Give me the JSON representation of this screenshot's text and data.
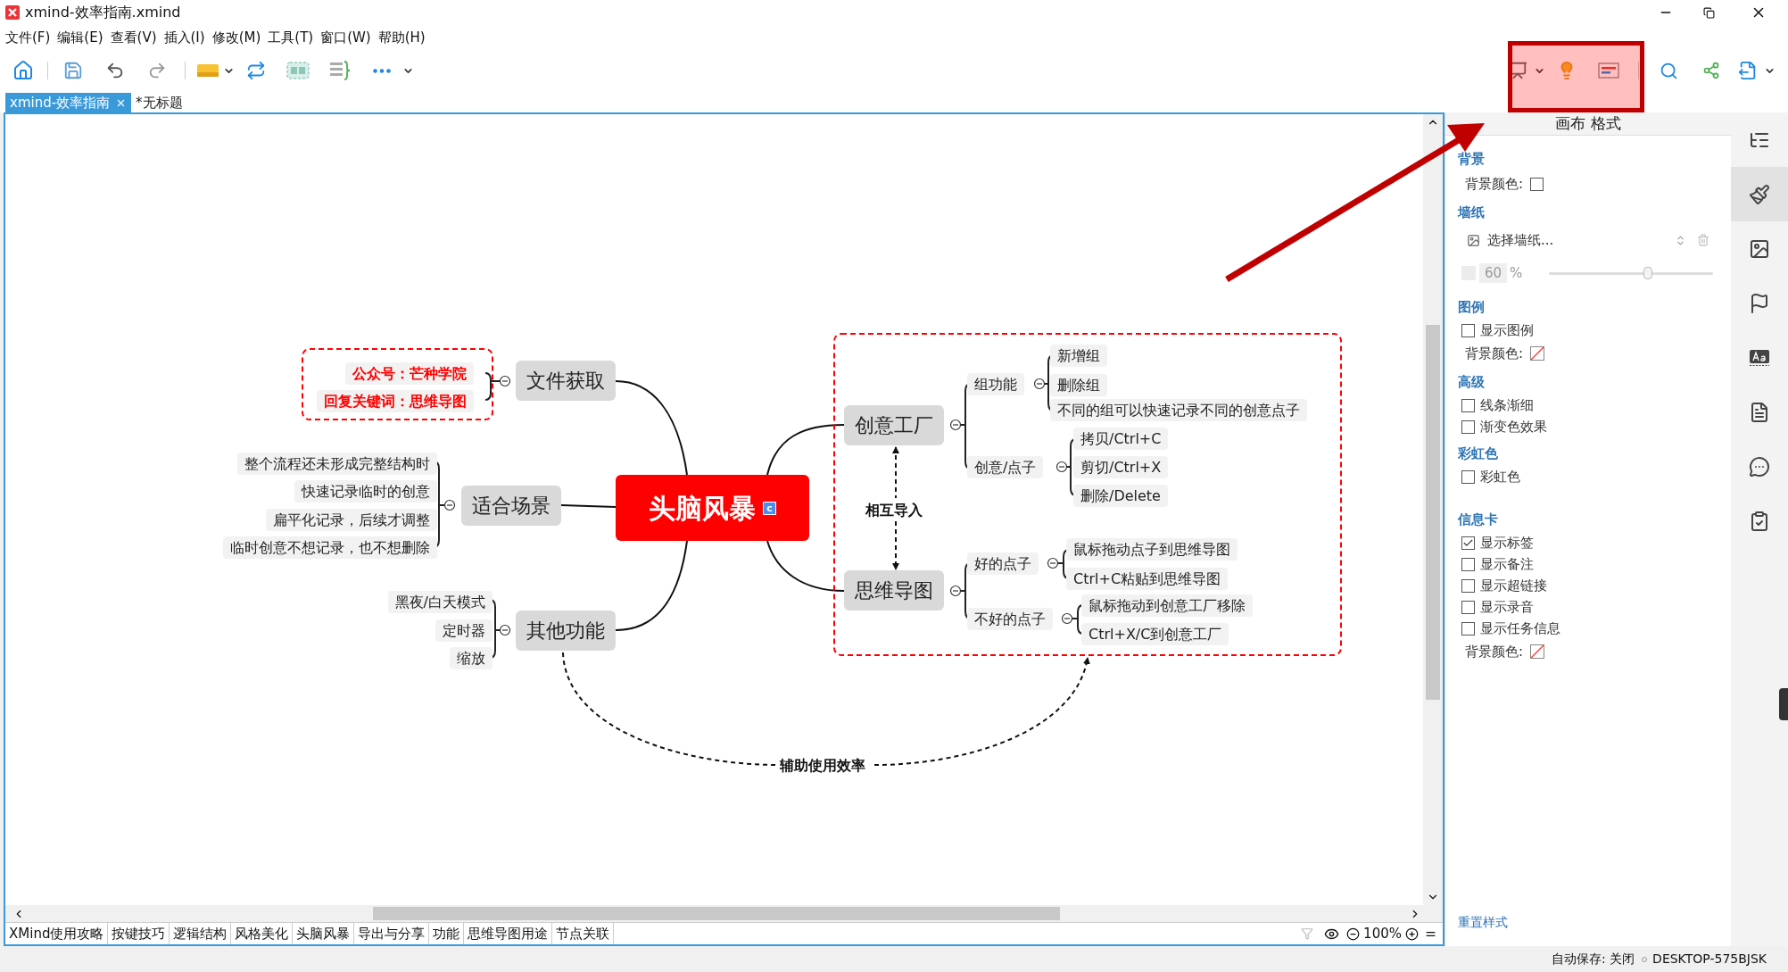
{
  "window": {
    "title": "xmind-效率指南.xmind"
  },
  "menu": [
    "文件(F)",
    "编辑(E)",
    "查看(V)",
    "插入(I)",
    "修改(M)",
    "工具(T)",
    "窗口(W)",
    "帮助(H)"
  ],
  "doc_tabs": [
    {
      "label": "xmind-效率指南",
      "selected": true
    },
    {
      "label": "*无标题",
      "selected": false
    }
  ],
  "mindmap": {
    "central": {
      "text": "头脑风暴",
      "marker": "c"
    },
    "left": [
      {
        "text": "文件获取",
        "boundary": true,
        "children": [
          {
            "text": "公众号：芒种学院",
            "highlight": true
          },
          {
            "text": "回复关键词：思维导图",
            "highlight": true
          }
        ]
      },
      {
        "text": "适合场景",
        "children": [
          {
            "text": "整个流程还未形成完整结构时",
            "highlight": false
          },
          {
            "text": "快速记录临时的创意",
            "highlight": false
          },
          {
            "text": "扁平化记录，后续才调整",
            "highlight": false
          },
          {
            "text": "临时创意不想记录，也不想删除",
            "highlight": false
          }
        ]
      },
      {
        "text": "其他功能",
        "children": [
          {
            "text": "黑夜/白天模式",
            "highlight": false
          },
          {
            "text": "定时器",
            "highlight": false
          },
          {
            "text": "缩放",
            "highlight": false
          }
        ]
      }
    ],
    "right_boundary": true,
    "right": [
      {
        "text": "创意工厂",
        "children": [
          {
            "text": "组功能",
            "children": [
              {
                "text": "新增组"
              },
              {
                "text": "删除组"
              },
              {
                "text": "不同的组可以快速记录不同的创意点子"
              }
            ]
          },
          {
            "text": "创意/点子",
            "children": [
              {
                "text": "拷贝/Ctrl+C"
              },
              {
                "text": "剪切/Ctrl+X"
              },
              {
                "text": "删除/Delete"
              }
            ]
          }
        ]
      },
      {
        "text": "思维导图",
        "children": [
          {
            "text": "好的点子",
            "children": [
              {
                "text": "鼠标拖动点子到思维导图"
              },
              {
                "text": "Ctrl+C粘贴到思维导图"
              }
            ]
          },
          {
            "text": "不好的点子",
            "children": [
              {
                "text": "鼠标拖动到创意工厂移除"
              },
              {
                "text": "Ctrl+X/C到创意工厂"
              }
            ]
          }
        ]
      }
    ],
    "relationships": [
      {
        "label": "相互导入"
      },
      {
        "label": "辅助使用效率"
      }
    ]
  },
  "format_panel": {
    "title": "画布 格式",
    "sections": [
      {
        "heading": "背景",
        "rows": [
          {
            "kind": "color",
            "label": "背景颜色:",
            "transparent": false
          }
        ]
      },
      {
        "heading": "墙纸",
        "rows": [
          {
            "kind": "wallpaper",
            "label": "选择墙纸..."
          },
          {
            "kind": "opacity",
            "value": "60",
            "unit": "%",
            "level": 0.6,
            "disabled": true
          }
        ]
      },
      {
        "heading": "图例",
        "rows": [
          {
            "kind": "check",
            "label": "显示图例",
            "checked": false
          },
          {
            "kind": "color",
            "label": "背景颜色:",
            "transparent": true
          }
        ]
      },
      {
        "heading": "高级",
        "rows": [
          {
            "kind": "check",
            "label": "线条渐细",
            "checked": false
          },
          {
            "kind": "check",
            "label": "渐变色效果",
            "checked": false
          }
        ]
      },
      {
        "heading": "彩虹色",
        "rows": [
          {
            "kind": "check",
            "label": "彩虹色",
            "checked": false
          }
        ]
      },
      {
        "heading": "信息卡",
        "rows": [
          {
            "kind": "check",
            "label": "显示标签",
            "checked": true
          },
          {
            "kind": "check",
            "label": "显示备注",
            "checked": false
          },
          {
            "kind": "check",
            "label": "显示超链接",
            "checked": false
          },
          {
            "kind": "check",
            "label": "显示录音",
            "checked": false
          },
          {
            "kind": "check",
            "label": "显示任务信息",
            "checked": false
          },
          {
            "kind": "color",
            "label": "背景颜色:",
            "transparent": true
          }
        ]
      }
    ],
    "reset": "重置样式"
  },
  "side_tabs": [
    {
      "selected": false
    },
    {
      "selected": true
    },
    {
      "selected": false
    },
    {
      "selected": false
    },
    {
      "selected": false
    },
    {
      "selected": false
    },
    {
      "selected": false
    },
    {
      "selected": false
    }
  ],
  "sheet_tabs": [
    "XMind使用攻略",
    "按键技巧",
    "逻辑结构",
    "风格美化",
    "头脑风暴",
    "导出与分享",
    "功能",
    "思维导图用途",
    "节点关联"
  ],
  "zoom": "100%",
  "status_bar": {
    "autosave": "自动保存: 关闭",
    "computer": "DESKTOP-575BJSK"
  }
}
